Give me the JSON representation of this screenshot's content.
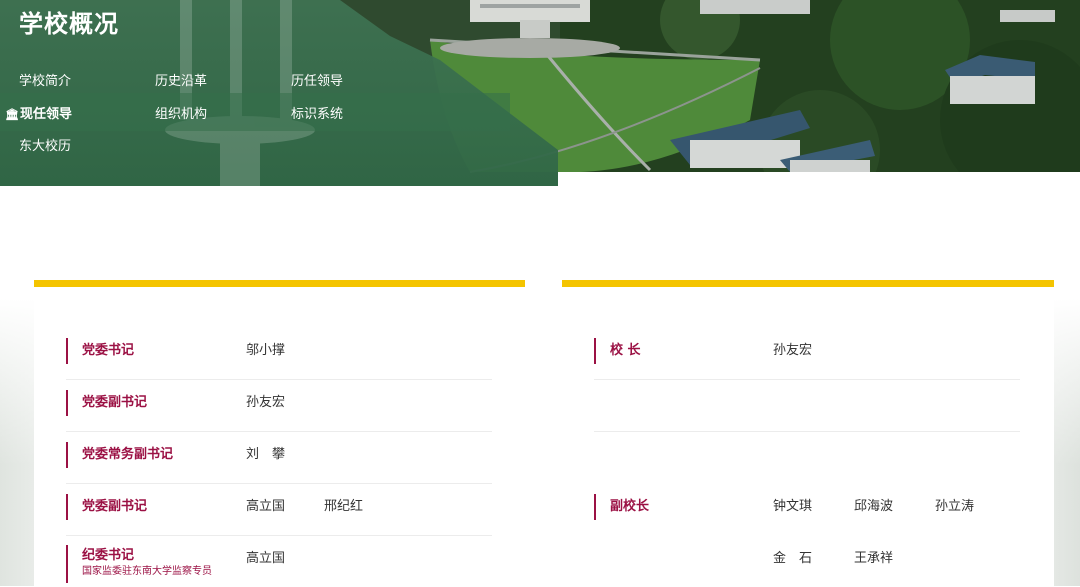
{
  "header": {
    "title": "学校概况",
    "nav": [
      {
        "label": "学校简介"
      },
      {
        "label": "历史沿革"
      },
      {
        "label": "历任领导"
      },
      {
        "label": "现任领导",
        "active": true
      },
      {
        "label": "组织机构"
      },
      {
        "label": "标识系统"
      },
      {
        "label": "东大校历"
      }
    ],
    "active_icon": "building-icon",
    "overlay_color": "#3f7353"
  },
  "left_panel": {
    "accent_color": "#f4c400",
    "role_color": "#9b1144",
    "rows": [
      {
        "role": "党委书记",
        "names": [
          "邬小撑"
        ]
      },
      {
        "role": "党委副书记",
        "names": [
          "孙友宏"
        ]
      },
      {
        "role": "党委常务副书记",
        "names": [
          "刘　攀"
        ]
      },
      {
        "role": "党委副书记",
        "names": [
          "高立国",
          "邢纪红"
        ]
      },
      {
        "role": "纪委书记",
        "subtitle": "国家监委驻东南大学监察专员",
        "names": [
          "高立国"
        ]
      }
    ]
  },
  "right_panel": {
    "rows": [
      {
        "role": "校 长",
        "names": [
          "孙友宏"
        ]
      },
      {
        "role": "副校长",
        "names": [
          "钟文琪",
          "邱海波",
          "孙立涛"
        ]
      },
      {
        "names": [
          "金　石",
          "王承祥"
        ]
      }
    ]
  }
}
